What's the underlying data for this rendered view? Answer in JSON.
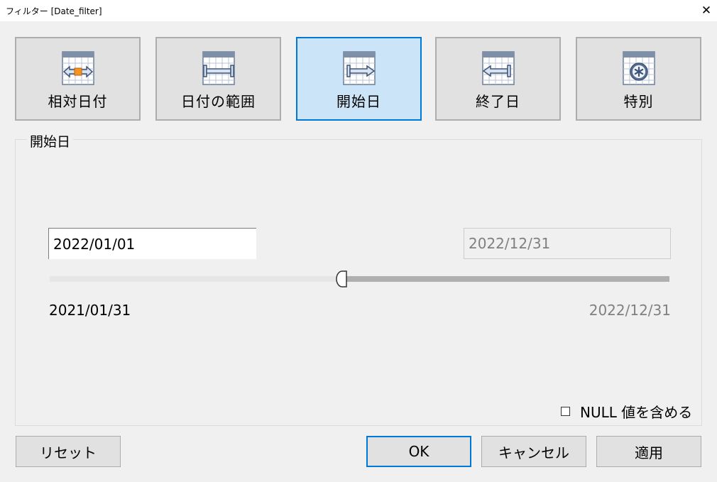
{
  "window": {
    "title": "フィルター [Date_filter]",
    "close_glyph": "✕"
  },
  "modes": [
    {
      "label": "相対日付",
      "icon": "relative-date-icon",
      "active": false
    },
    {
      "label": "日付の範囲",
      "icon": "date-range-icon",
      "active": false
    },
    {
      "label": "開始日",
      "icon": "start-date-icon",
      "active": true
    },
    {
      "label": "終了日",
      "icon": "end-date-icon",
      "active": false
    },
    {
      "label": "特別",
      "icon": "special-icon",
      "active": false
    }
  ],
  "group": {
    "title": "開始日",
    "start_value": "2022/01/01",
    "end_value": "2022/12/31",
    "range_min": "2021/01/31",
    "range_max": "2022/12/31",
    "slider_position": 0.5
  },
  "null_option": {
    "label": "NULL 値を含める",
    "checked": false
  },
  "buttons": {
    "reset": "リセット",
    "ok": "OK",
    "cancel": "キャンセル",
    "apply": "適用"
  },
  "colors": {
    "active_fill": "#cce4f7",
    "active_border": "#0078d7",
    "button_fill": "#e1e1e1",
    "button_border": "#adadad",
    "disabled_text": "#808080",
    "icon_blue": "#5a6f8f",
    "icon_orange": "#f7941d"
  }
}
